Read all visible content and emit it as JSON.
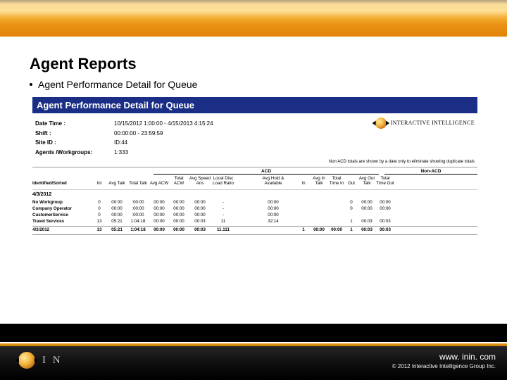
{
  "slide": {
    "title": "Agent Reports",
    "bullet": "Agent Performance Detail for Queue"
  },
  "report": {
    "title": "Agent Performance Detail for Queue",
    "brand": "INTERACTIVE INTELLIGENCE",
    "meta": {
      "date_time_label": "Date Time :",
      "date_time_value": "10/15/2012 1:00:00 - 4/15/2013 4:15:24",
      "shift_label": "Shift :",
      "shift_value": "00:00:00 - 23:59:59",
      "site_label": "Site ID :",
      "site_value": "ID:44",
      "agents_label": "Agents /Workgroups:",
      "agents_value": "1:333"
    },
    "footnote": "Non ACD totals are shown by a date only to eliminate showing duplicate totals",
    "section_acd": "ACD",
    "section_nonacd": "Non-ACD",
    "columns": {
      "name": "Identified/Sorted",
      "int": "Int",
      "c1": "Avg\nTalk",
      "c2": "Total\nTalk",
      "c3": "Avg\nACW",
      "c4": "Total\nACW",
      "c5": "Avg\nSpeed\nAns",
      "c6": "Local Disc\nLoad Ratio",
      "c7": "",
      "c8": "Avg Hold &\nAvailable",
      "n1": "In",
      "n2": "Avg\nIn\nTalk",
      "n3": "Total\nTime In",
      "n4": "Out",
      "n5": "Avg\nOut\nTalk",
      "n6": "Total\nTime\nOut"
    },
    "date_header": "4/3/2012",
    "rows": [
      {
        "name": "No Workgroup",
        "int": "0",
        "c1": "00:00",
        "c2": ":00:00",
        "c3": "00:00",
        "c4": "00:00",
        "c5": "00:00",
        "c6": "-",
        "c8": "00:00",
        "n1": "",
        "n2": "",
        "n3": "",
        "n4": "0",
        "n5": "00:00",
        "n6": "00:00"
      },
      {
        "name": "Company Operator",
        "int": "0",
        "c1": "00:00",
        "c2": ":00:00",
        "c3": "00:00",
        "c4": "00:00",
        "c5": "00:00",
        "c6": "-",
        "c8": "00:00",
        "n1": "",
        "n2": "",
        "n3": "",
        "n4": "0",
        "n5": "00:00",
        "n6": "00:00"
      },
      {
        "name": "CustomerService",
        "int": "0",
        "c1": "00:00",
        "c2": ":00:00",
        "c3": "00:00",
        "c4": "00:00",
        "c5": "00:00",
        "c6": "-",
        "c8": "00:00",
        "n1": "",
        "n2": "",
        "n3": "",
        "n4": "",
        "n5": "",
        "n6": ""
      },
      {
        "name": "Travel Services",
        "int": "13",
        "c1": "05:21",
        "c2": "1:04:18",
        "c3": "00:00",
        "c4": "00:00",
        "c5": "00:03",
        "c6": "11",
        "c8": "32:14",
        "n1": "",
        "n2": "",
        "n3": "",
        "n4": "1",
        "n5": "00:03",
        "n6": "00:03"
      }
    ],
    "total": {
      "name": "4/3/2012",
      "int": "13",
      "c1": "05:21",
      "c2": "1:04:18",
      "c3": "00:00",
      "c4": "00:00",
      "c5": "00:03",
      "c6": "11.111",
      "c8": "",
      "n1": "1",
      "n2": "00:00",
      "n3": "00:00",
      "n4": "1",
      "n5": "00:03",
      "n6": "00:03"
    }
  },
  "footer": {
    "brand_short": "I N",
    "url": "www. inin. com",
    "copyright": "© 2012 Interactive Intelligence Group Inc."
  }
}
